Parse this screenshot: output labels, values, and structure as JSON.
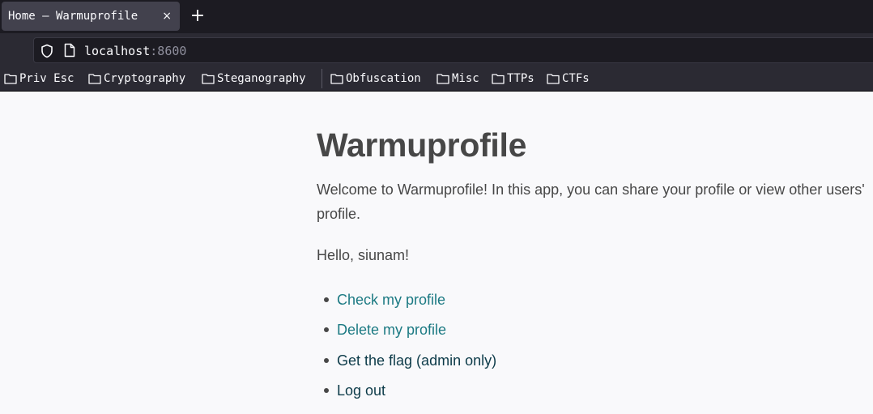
{
  "browser": {
    "tab": {
      "title": "Home – Warmuprofile",
      "close": "×"
    },
    "new_tab": "+",
    "url": {
      "host": "localhost",
      "port": ":8600"
    },
    "bookmarks": [
      {
        "label": "Priv Esc"
      },
      {
        "label": "Cryptography"
      },
      {
        "label": "Steganography"
      },
      {
        "label": "Obfuscation"
      },
      {
        "label": "Misc"
      },
      {
        "label": "TTPs"
      },
      {
        "label": "CTFs"
      }
    ]
  },
  "page": {
    "title": "Warmuprofile",
    "intro": "Welcome to Warmuprofile! In this app, you can share your profile or view other users' profile.",
    "greeting": "Hello, siunam!",
    "links": [
      {
        "label": "Check my profile"
      },
      {
        "label": "Delete my profile"
      },
      {
        "label": "Get the flag (admin only)"
      },
      {
        "label": "Log out"
      }
    ]
  },
  "colors": {
    "tab_bar": "#1c1b22",
    "toolbar": "#2b2a33",
    "page_bg": "#f9f9fb",
    "text": "#474747",
    "link_teal": "#1c7a83",
    "link_dark": "#0d3b49"
  }
}
